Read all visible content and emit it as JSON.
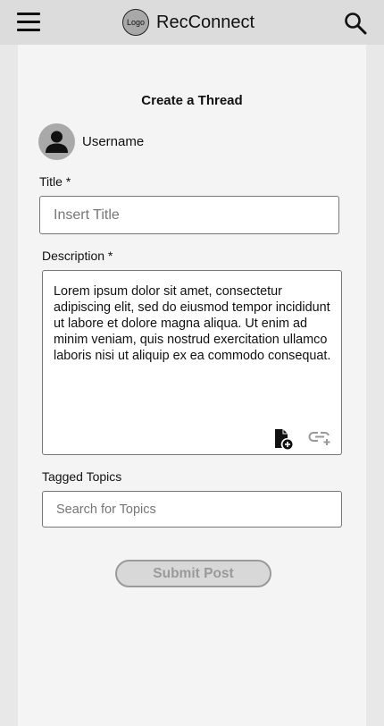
{
  "header": {
    "logo_text": "Logo",
    "app_name": "RecConnect",
    "menu_icon": "hamburger-menu-icon",
    "search_icon": "search-icon"
  },
  "form": {
    "heading": "Create a Thread",
    "username": "Username",
    "title_label": "Title *",
    "title_placeholder": "Insert Title",
    "description_label": "Description *",
    "description_value": "Lorem ipsum dolor sit amet, consectetur adipiscing elit, sed do eiusmod tempor incididunt ut labore et dolore magna aliqua. Ut enim ad minim veniam, quis nostrud exercitation ullamco laboris nisi ut aliquip ex ea commodo consequat.",
    "attach_icon": "add-file-icon",
    "link_icon": "add-link-icon",
    "topics_label": "Tagged Topics",
    "topics_placeholder": "Search for Topics",
    "submit_label": "Submit Post"
  },
  "colors": {
    "topbar": "#dcdcdc",
    "panel": "#f4f4f4",
    "background": "#e8e8e8",
    "disabled_text": "#9a9a9a"
  }
}
